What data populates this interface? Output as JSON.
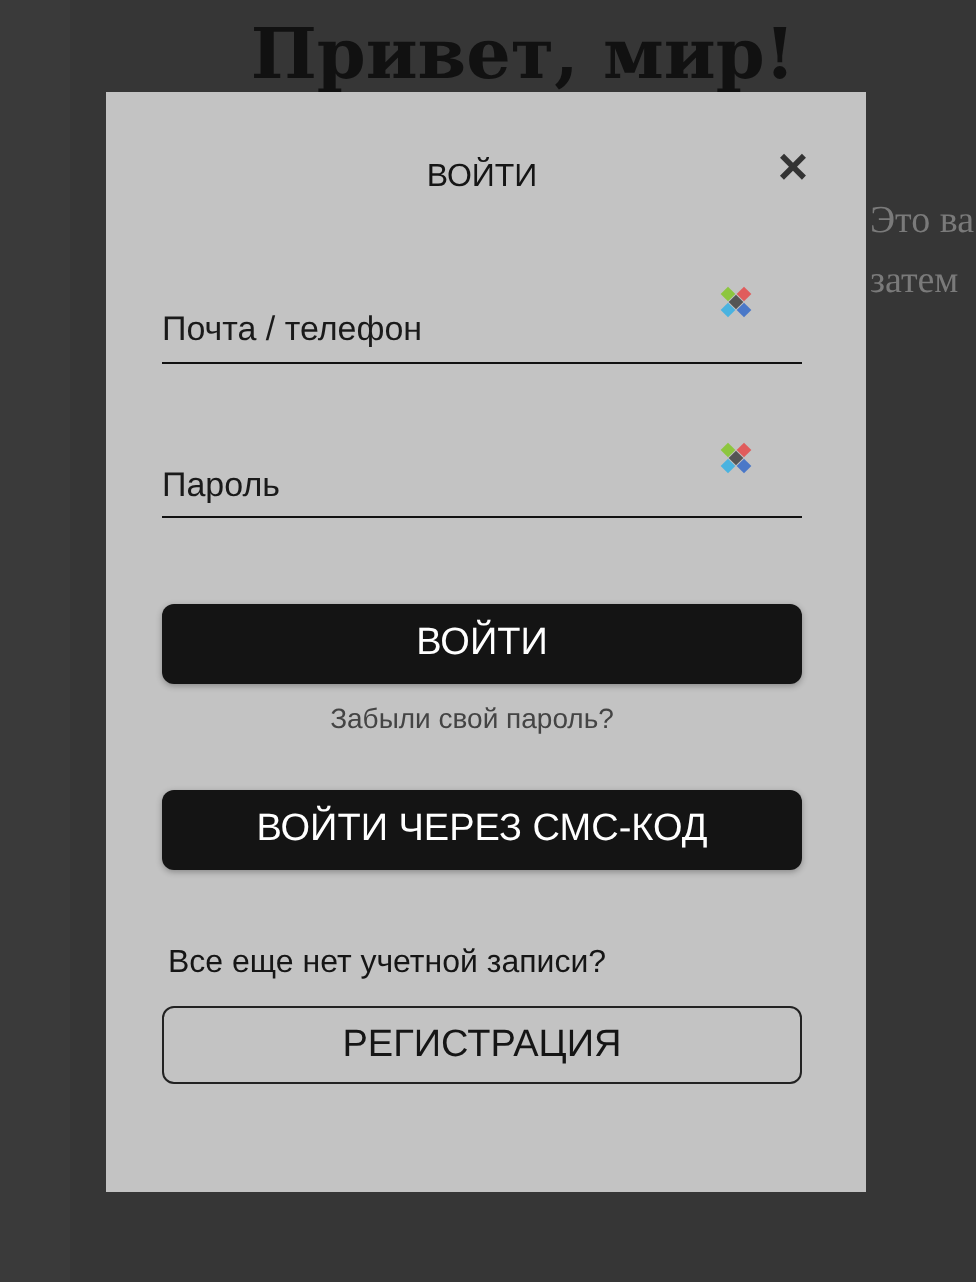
{
  "page": {
    "heading": "Привет, мир!",
    "text_lines": [
      "Это ва",
      "затем"
    ]
  },
  "modal": {
    "title": "ВОЙТИ",
    "close": "×",
    "fields": [
      {
        "placeholder": "Почта / телефон"
      },
      {
        "placeholder": "Пароль"
      }
    ],
    "login_button": "ВОЙТИ",
    "forgot_link": "Забыли свой пароль?",
    "sms_button": "ВОЙТИ ЧЕРЕЗ СМС-КОД",
    "no_account": "Все еще нет учетной записи?",
    "register_button": "РЕГИСТРАЦИЯ"
  }
}
